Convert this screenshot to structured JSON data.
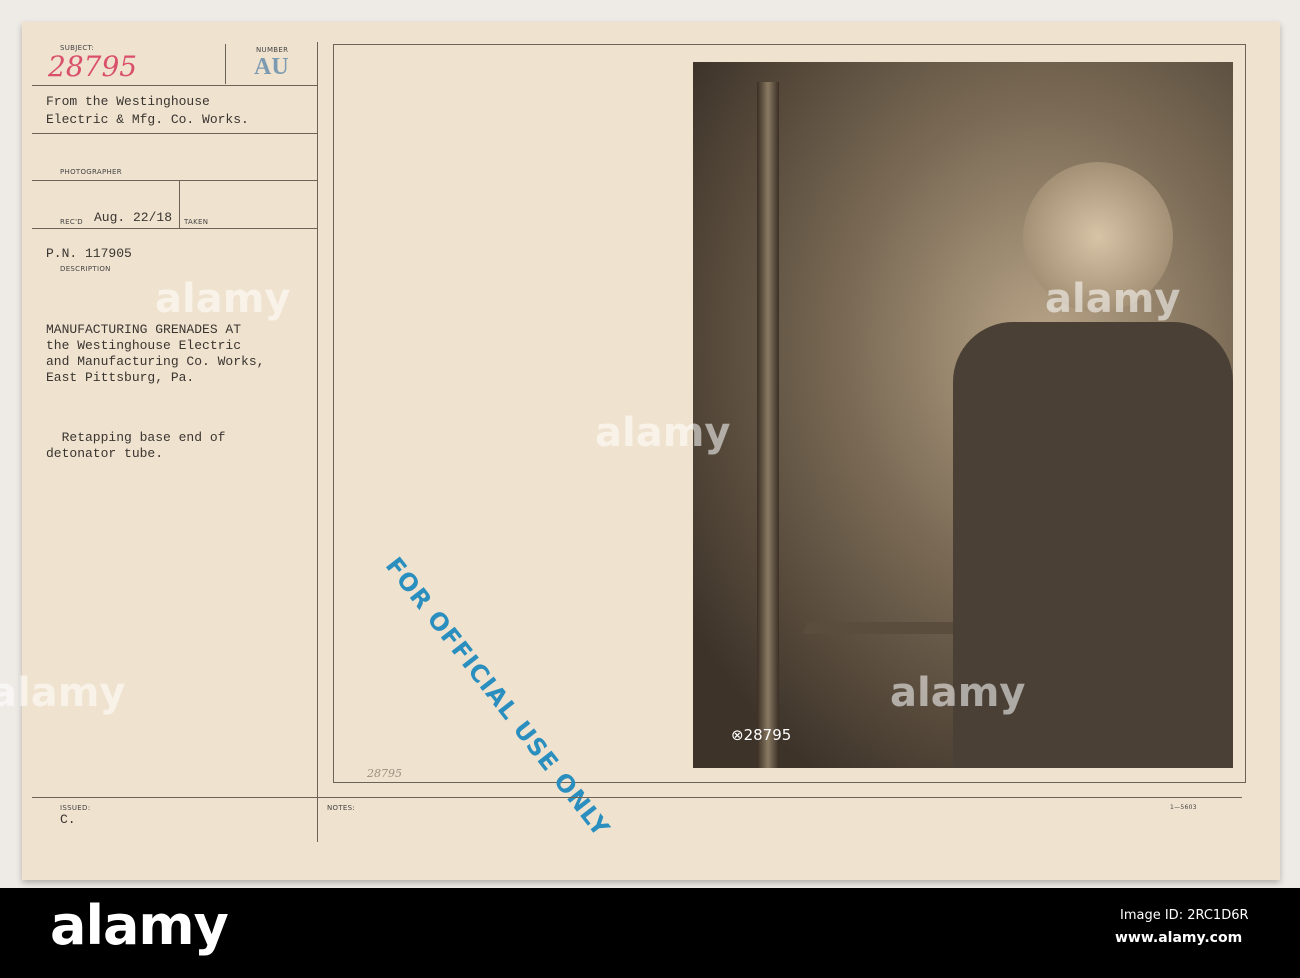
{
  "card": {
    "subject_label": "SUBJECT:",
    "subject_value": "28795",
    "number_label": "NUMBER",
    "number_value": "AU",
    "source_line1": "From the Westinghouse",
    "source_line2": "Electric & Mfg. Co. Works.",
    "photographer_label": "PHOTOGRAPHER",
    "recd_label": "REC'D",
    "recd_value": "Aug. 22/18",
    "taken_label": "TAKEN",
    "pn": "P.N. 117905",
    "description_label": "DESCRIPTION",
    "description_lines": [
      "MANUFACTURING GRENADES AT",
      "the Westinghouse Electric",
      "and Manufacturing Co. Works,",
      "East Pittsburg, Pa."
    ],
    "caption_lines": [
      "  Retapping base end of",
      "detonator tube."
    ],
    "issued_label": "ISSUED:",
    "issued_value": "C.",
    "notes_label": "NOTES:",
    "form_number": "1—5603",
    "pencil_number": "28795",
    "photo_number": "⊗28795",
    "stamp": "FOR OFFICIAL USE ONLY"
  },
  "watermark": "alamy",
  "footer": {
    "image_id": "Image ID: 2RC1D6R",
    "site": "www.alamy.com",
    "logo": "alamy"
  }
}
